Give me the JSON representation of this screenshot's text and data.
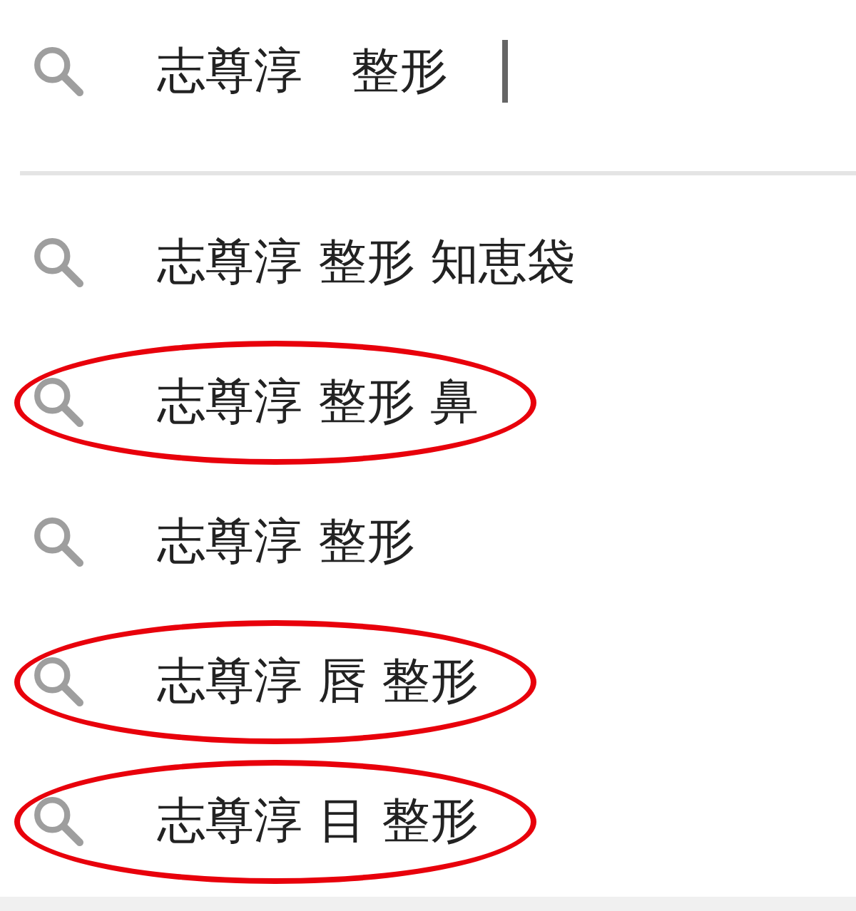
{
  "search": {
    "value": "志尊淳　整形"
  },
  "suggestions": [
    {
      "text": "志尊淳 整形 知恵袋",
      "circled": false
    },
    {
      "text": "志尊淳 整形 鼻",
      "circled": true
    },
    {
      "text": "志尊淳 整形",
      "circled": false
    },
    {
      "text": "志尊淳 唇 整形",
      "circled": true
    },
    {
      "text": "志尊淳 目 整形",
      "circled": true
    }
  ]
}
